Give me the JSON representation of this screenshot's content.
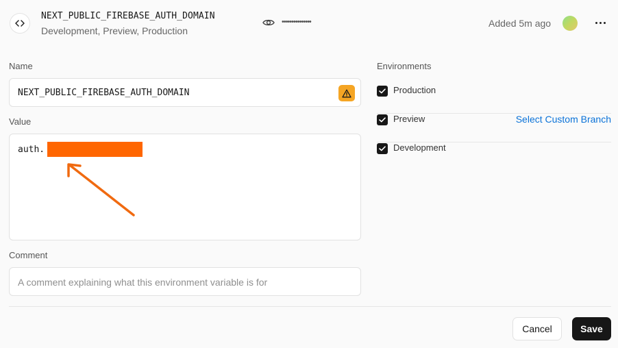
{
  "header": {
    "variable_name": "NEXT_PUBLIC_FIREBASE_AUTH_DOMAIN",
    "environments_summary": "Development, Preview, Production",
    "masked_value": "•••••••••••••••",
    "added_text": "Added 5m ago"
  },
  "form": {
    "name_label": "Name",
    "name_value": "NEXT_PUBLIC_FIREBASE_AUTH_DOMAIN",
    "value_label": "Value",
    "value_prefix": "auth.",
    "comment_label": "Comment",
    "comment_placeholder": "A comment explaining what this environment variable is for"
  },
  "environments": {
    "label": "Environments",
    "items": [
      {
        "label": "Production",
        "checked": true
      },
      {
        "label": "Preview",
        "checked": true,
        "link": "Select Custom Branch"
      },
      {
        "label": "Development",
        "checked": true
      }
    ]
  },
  "actions": {
    "cancel_label": "Cancel",
    "save_label": "Save"
  },
  "colors": {
    "accent_link": "#0a72d8",
    "warning": "#f5a524",
    "redaction": "#ff6600",
    "primary_button": "#171717"
  }
}
